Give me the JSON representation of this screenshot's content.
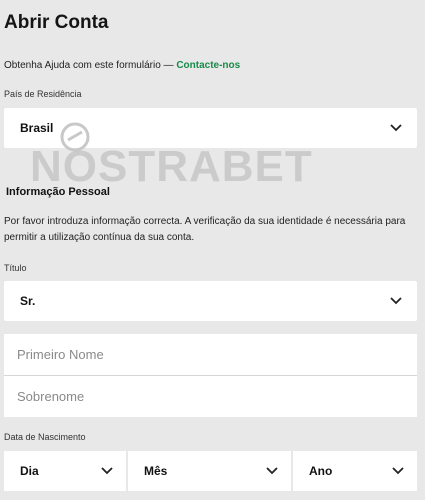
{
  "header": {
    "title": "Abrir Conta"
  },
  "help": {
    "text": "Obtenha Ajuda com este formulário — ",
    "link_label": "Contacte-nos"
  },
  "country": {
    "label": "País de Residência",
    "selected": "Brasil"
  },
  "watermark": {
    "text": "NOSTRABET"
  },
  "personal_info": {
    "title": "Informação Pessoal",
    "description": "Por favor introduza informação correcta. A verificação da sua identidade é necessária para permitir a utilização contínua da sua conta."
  },
  "salutation": {
    "label": "Título",
    "selected": "Sr."
  },
  "name": {
    "first_placeholder": "Primeiro Nome",
    "last_placeholder": "Sobrenome"
  },
  "birthdate": {
    "label": "Data de Nascimento",
    "day": "Dia",
    "month": "Mês",
    "year": "Ano"
  },
  "colors": {
    "background": "#e8e8e8",
    "link": "#178a4a",
    "field": "#ffffff"
  },
  "icons": {
    "dropdown": "chevron-down-icon"
  }
}
